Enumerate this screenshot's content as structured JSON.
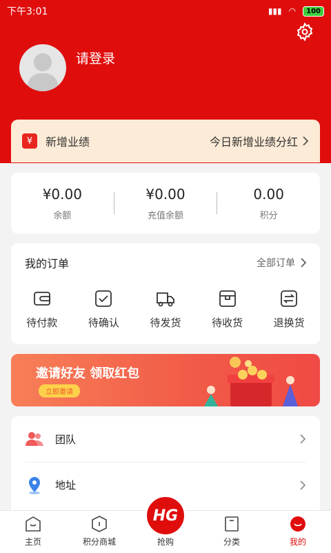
{
  "status_bar": {
    "time": "下午3:01",
    "battery": "100"
  },
  "profile": {
    "login_text": "请登录"
  },
  "performance": {
    "icon_text": "¥",
    "title": "新增业绩",
    "link": "今日新增业绩分红"
  },
  "balance": [
    {
      "value": "¥0.00",
      "label": "余额"
    },
    {
      "value": "¥0.00",
      "label": "充值余额"
    },
    {
      "value": "0.00",
      "label": "积分"
    }
  ],
  "orders": {
    "title": "我的订单",
    "all_label": "全部订单",
    "items": [
      {
        "label": "待付款",
        "icon": "wallet-icon"
      },
      {
        "label": "待确认",
        "icon": "check-icon"
      },
      {
        "label": "待发货",
        "icon": "truck-icon"
      },
      {
        "label": "待收货",
        "icon": "box-icon"
      },
      {
        "label": "退换货",
        "icon": "exchange-icon"
      }
    ]
  },
  "banner": {
    "title": "邀请好友 领取红包",
    "button": "立即邀请"
  },
  "menu": [
    {
      "label": "团队",
      "icon": "team-icon"
    },
    {
      "label": "地址",
      "icon": "location-icon"
    }
  ],
  "tabbar": {
    "center_logo": "HG",
    "tabs": [
      {
        "label": "主页",
        "icon": "home-icon"
      },
      {
        "label": "积分商城",
        "icon": "points-mall-icon"
      },
      {
        "label": "抢购",
        "icon": "flash-sale-icon"
      },
      {
        "label": "分类",
        "icon": "category-icon"
      },
      {
        "label": "我的",
        "icon": "profile-icon"
      }
    ],
    "active_color": "#e00d0d"
  },
  "colors": {
    "brand_red": "#e00d0d",
    "perf_bg": "#fcebd7"
  }
}
